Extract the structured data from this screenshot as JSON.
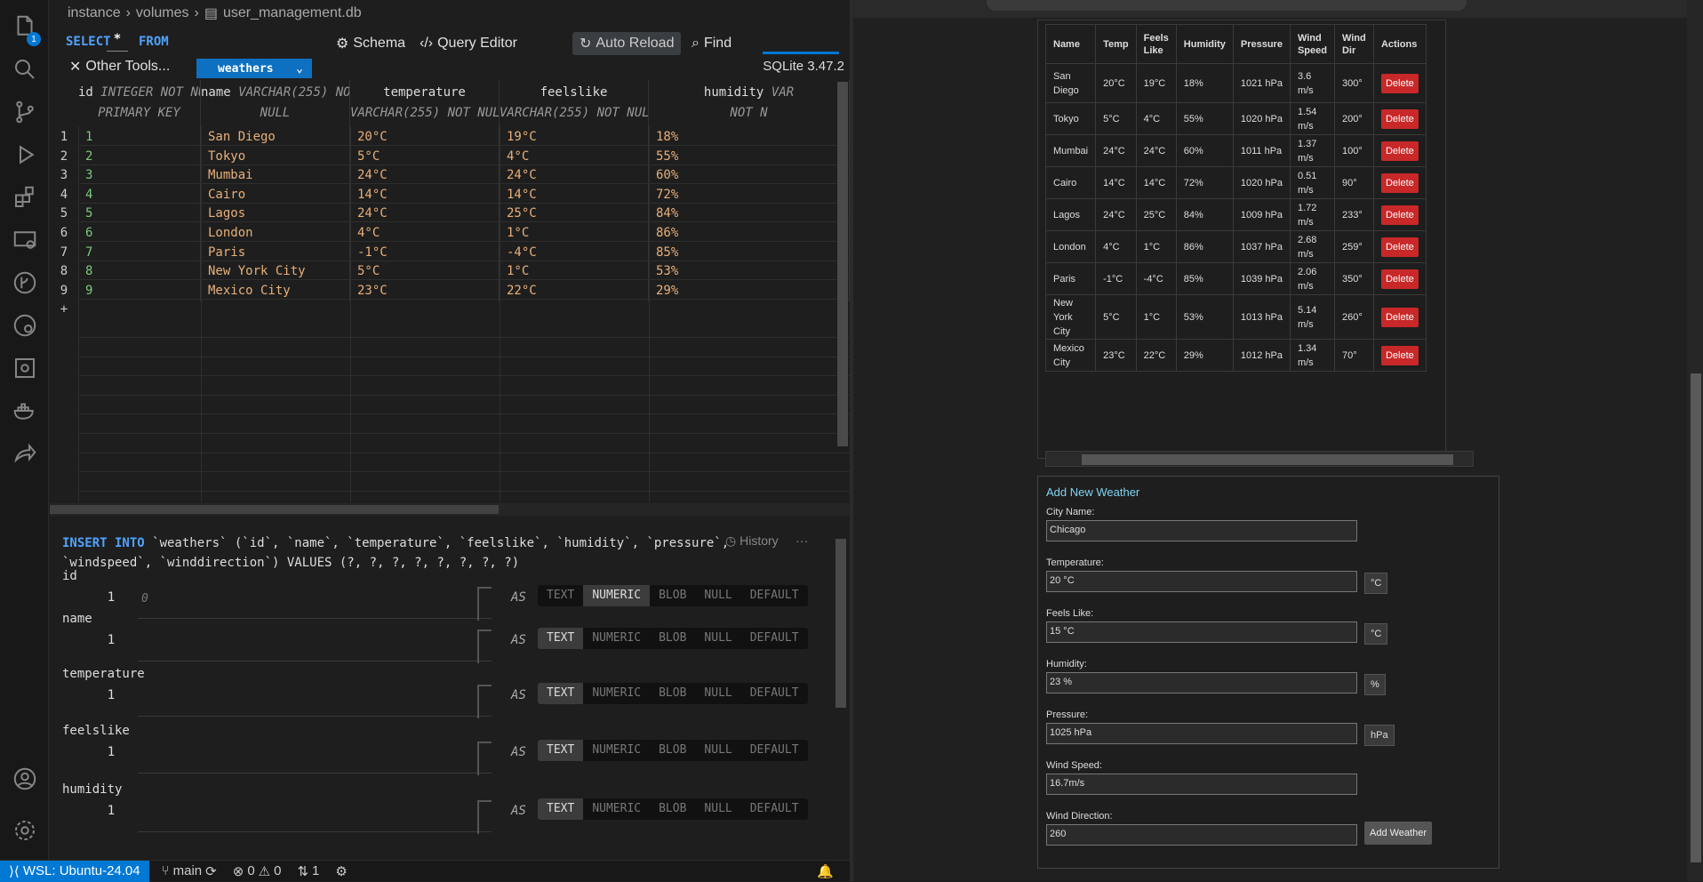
{
  "breadcrumb": {
    "parts": [
      "instance",
      "volumes",
      "user_management.db"
    ]
  },
  "toolbar": {
    "select": "SELECT",
    "star": "*",
    "from": "FROM",
    "table": "weathers",
    "schema": "Schema",
    "query_editor": "Query Editor",
    "auto_reload": "Auto Reload",
    "find": "Find",
    "other_tools": "Other Tools...",
    "version": "SQLite 3.47.2"
  },
  "grid": {
    "columns": [
      {
        "name": "id",
        "type1": "INTEGER NOT NULL",
        "type2": "PRIMARY KEY"
      },
      {
        "name": "name",
        "type1": "VARCHAR(255) NOT",
        "type2": "NULL"
      },
      {
        "name": "temperature",
        "type1": "",
        "type2": "VARCHAR(255) NOT NULL"
      },
      {
        "name": "feelslike",
        "type1": "",
        "type2": "VARCHAR(255) NOT NULL"
      },
      {
        "name": "humidity",
        "type1": "VAR",
        "type2": "NOT N"
      }
    ],
    "rows": [
      [
        "1",
        "1",
        "San Diego",
        "20°C",
        "19°C",
        "18%"
      ],
      [
        "2",
        "2",
        "Tokyo",
        "5°C",
        "4°C",
        "55%"
      ],
      [
        "3",
        "3",
        "Mumbai",
        "24°C",
        "24°C",
        "60%"
      ],
      [
        "4",
        "4",
        "Cairo",
        "14°C",
        "14°C",
        "72%"
      ],
      [
        "5",
        "5",
        "Lagos",
        "24°C",
        "25°C",
        "84%"
      ],
      [
        "6",
        "6",
        "London",
        "4°C",
        "1°C",
        "86%"
      ],
      [
        "7",
        "7",
        "Paris",
        "-1°C",
        "-4°C",
        "85%"
      ],
      [
        "8",
        "8",
        "New York City",
        "5°C",
        "1°C",
        "53%"
      ],
      [
        "9",
        "9",
        "Mexico City",
        "23°C",
        "22°C",
        "29%"
      ]
    ],
    "add_row": "+"
  },
  "insert": {
    "keyword": "INSERT INTO",
    "sql_rest1": " `weathers` (`id`, `name`, `temperature`, `feelslike`, `humidity`, `pressure`,",
    "sql_rest2": "`windspeed`, `winddirection`) VALUES (?, ?, ?, ?, ?, ?, ?, ?)",
    "history": "History",
    "more": "···",
    "as": "AS",
    "type_options": [
      "TEXT",
      "NUMERIC",
      "BLOB",
      "NULL",
      "DEFAULT"
    ],
    "fields": [
      {
        "name": "id",
        "index": "1",
        "placeholder": "0",
        "selected": "NUMERIC"
      },
      {
        "name": "name",
        "index": "1",
        "placeholder": "",
        "selected": "TEXT"
      },
      {
        "name": "temperature",
        "index": "1",
        "placeholder": "",
        "selected": "TEXT"
      },
      {
        "name": "feelslike",
        "index": "1",
        "placeholder": "",
        "selected": "TEXT"
      },
      {
        "name": "humidity",
        "index": "1",
        "placeholder": "",
        "selected": "TEXT"
      }
    ]
  },
  "status": {
    "wsl": "WSL: Ubuntu-24.04",
    "branch": "main",
    "errors": "0",
    "warnings": "0",
    "ports": "1"
  },
  "weather_table": {
    "headers": [
      "Name",
      "Temp",
      "Feels Like",
      "Humidity",
      "Pressure",
      "Wind Speed",
      "Wind Dir",
      "Actions"
    ],
    "rows": [
      [
        "San Diego",
        "20°C",
        "19°C",
        "18%",
        "1021 hPa",
        "3.6 m/s",
        "300°"
      ],
      [
        "Tokyo",
        "5°C",
        "4°C",
        "55%",
        "1020 hPa",
        "1.54 m/s",
        "200°"
      ],
      [
        "Mumbai",
        "24°C",
        "24°C",
        "60%",
        "1011 hPa",
        "1.37 m/s",
        "100°"
      ],
      [
        "Cairo",
        "14°C",
        "14°C",
        "72%",
        "1020 hPa",
        "0.51 m/s",
        "90°"
      ],
      [
        "Lagos",
        "24°C",
        "25°C",
        "84%",
        "1009 hPa",
        "1.72 m/s",
        "233°"
      ],
      [
        "London",
        "4°C",
        "1°C",
        "86%",
        "1037 hPa",
        "2.68 m/s",
        "259°"
      ],
      [
        "Paris",
        "-1°C",
        "-4°C",
        "85%",
        "1039 hPa",
        "2.06 m/s",
        "350°"
      ],
      [
        "New York City",
        "5°C",
        "1°C",
        "53%",
        "1013 hPa",
        "5.14 m/s",
        "260°"
      ],
      [
        "Mexico City",
        "23°C",
        "22°C",
        "29%",
        "1012 hPa",
        "1.34 m/s",
        "70°"
      ]
    ],
    "delete_label": "Delete"
  },
  "form": {
    "title": "Add New Weather",
    "fields": [
      {
        "label": "City Name:",
        "value": "Chicago",
        "unit": ""
      },
      {
        "label": "Temperature:",
        "value": "20 °C",
        "unit": "°C"
      },
      {
        "label": "Feels Like:",
        "value": "15 °C",
        "unit": "°C"
      },
      {
        "label": "Humidity:",
        "value": "23 %",
        "unit": "%"
      },
      {
        "label": "Pressure:",
        "value": "1025 hPa",
        "unit": "hPa"
      },
      {
        "label": "Wind Speed:",
        "value": "16.7m/s",
        "unit": ""
      },
      {
        "label": "Wind Direction:",
        "value": "260",
        "unit": ""
      }
    ],
    "submit": "Add Weather"
  },
  "activity": {
    "badge": "1"
  }
}
